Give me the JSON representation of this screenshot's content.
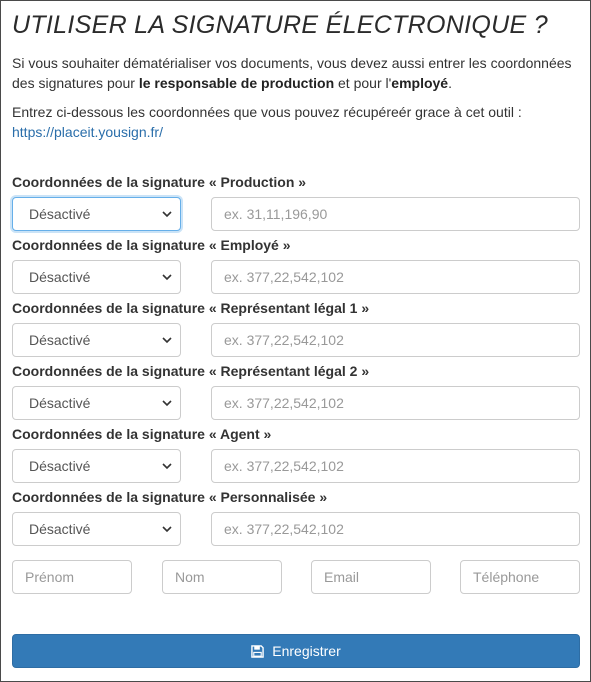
{
  "title": "UTILISER LA SIGNATURE ÉLECTRONIQUE ?",
  "intro": {
    "text_before": "Si vous souhaiter dématérialiser vos documents, vous devez aussi entrer les coordonnées des signatures pour ",
    "bold1": "le responsable de production",
    "text_middle": " et pour l'",
    "bold2": "employé",
    "text_after": "."
  },
  "instructions": {
    "text": "Entrez ci-dessous les coordonnées que vous pouvez récupéreér grace à cet outil :",
    "link": "https://placeit.yousign.fr/"
  },
  "signatures": [
    {
      "label": "Coordonnées de la signature « Production »",
      "selected": "Désactivé",
      "placeholder": "ex. 31,11,196,90"
    },
    {
      "label": "Coordonnées de la signature « Employé »",
      "selected": "Désactivé",
      "placeholder": "ex. 377,22,542,102"
    },
    {
      "label": "Coordonnées de la signature « Représentant légal 1 »",
      "selected": "Désactivé",
      "placeholder": "ex. 377,22,542,102"
    },
    {
      "label": "Coordonnées de la signature « Représentant légal 2 »",
      "selected": "Désactivé",
      "placeholder": "ex. 377,22,542,102"
    },
    {
      "label": "Coordonnées de la signature « Agent »",
      "selected": "Désactivé",
      "placeholder": "ex. 377,22,542,102"
    },
    {
      "label": "Coordonnées de la signature « Personnalisée »",
      "selected": "Désactivé",
      "placeholder": "ex. 377,22,542,102"
    }
  ],
  "contact": {
    "firstname_placeholder": "Prénom",
    "lastname_placeholder": "Nom",
    "email_placeholder": "Email",
    "phone_placeholder": "Téléphone"
  },
  "save_button": {
    "label": "Enregistrer",
    "icon": "floppy-disk-icon"
  },
  "colors": {
    "primary": "#337ab7",
    "link": "#2a6eaa",
    "focus": "#66afe9"
  }
}
